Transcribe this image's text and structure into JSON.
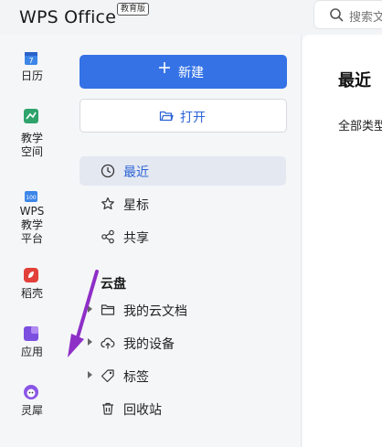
{
  "app": {
    "title": "WPS Office",
    "edition_badge": "教育版"
  },
  "search": {
    "placeholder": "搜索文"
  },
  "rail": [
    {
      "label": "日历",
      "icon": "calendar-icon"
    },
    {
      "label": "教学\n空间",
      "icon": "teaching-space-icon"
    },
    {
      "label": "WPS\n教学\n平台",
      "icon": "teaching-platform-icon"
    },
    {
      "label": "稻壳",
      "icon": "docer-icon"
    },
    {
      "label": "应用",
      "icon": "apps-icon"
    },
    {
      "label": "灵犀",
      "icon": "lingxi-icon"
    }
  ],
  "nav": {
    "new_label": "新建",
    "open_label": "打开",
    "items": [
      {
        "label": "最近",
        "icon": "clock-icon"
      },
      {
        "label": "星标",
        "icon": "star-icon"
      },
      {
        "label": "共享",
        "icon": "share-icon"
      }
    ],
    "cloud_section": "云盘",
    "cloud_items": [
      {
        "label": "我的云文档",
        "icon": "folder-icon"
      },
      {
        "label": "我的设备",
        "icon": "cloud-upload-icon"
      },
      {
        "label": "标签",
        "icon": "tag-icon"
      },
      {
        "label": "回收站",
        "icon": "trash-icon"
      }
    ]
  },
  "main": {
    "title": "最近",
    "filter": "全部类型"
  },
  "colors": {
    "accent": "#3472e6",
    "annotation_arrow": "#8e2fc7"
  }
}
